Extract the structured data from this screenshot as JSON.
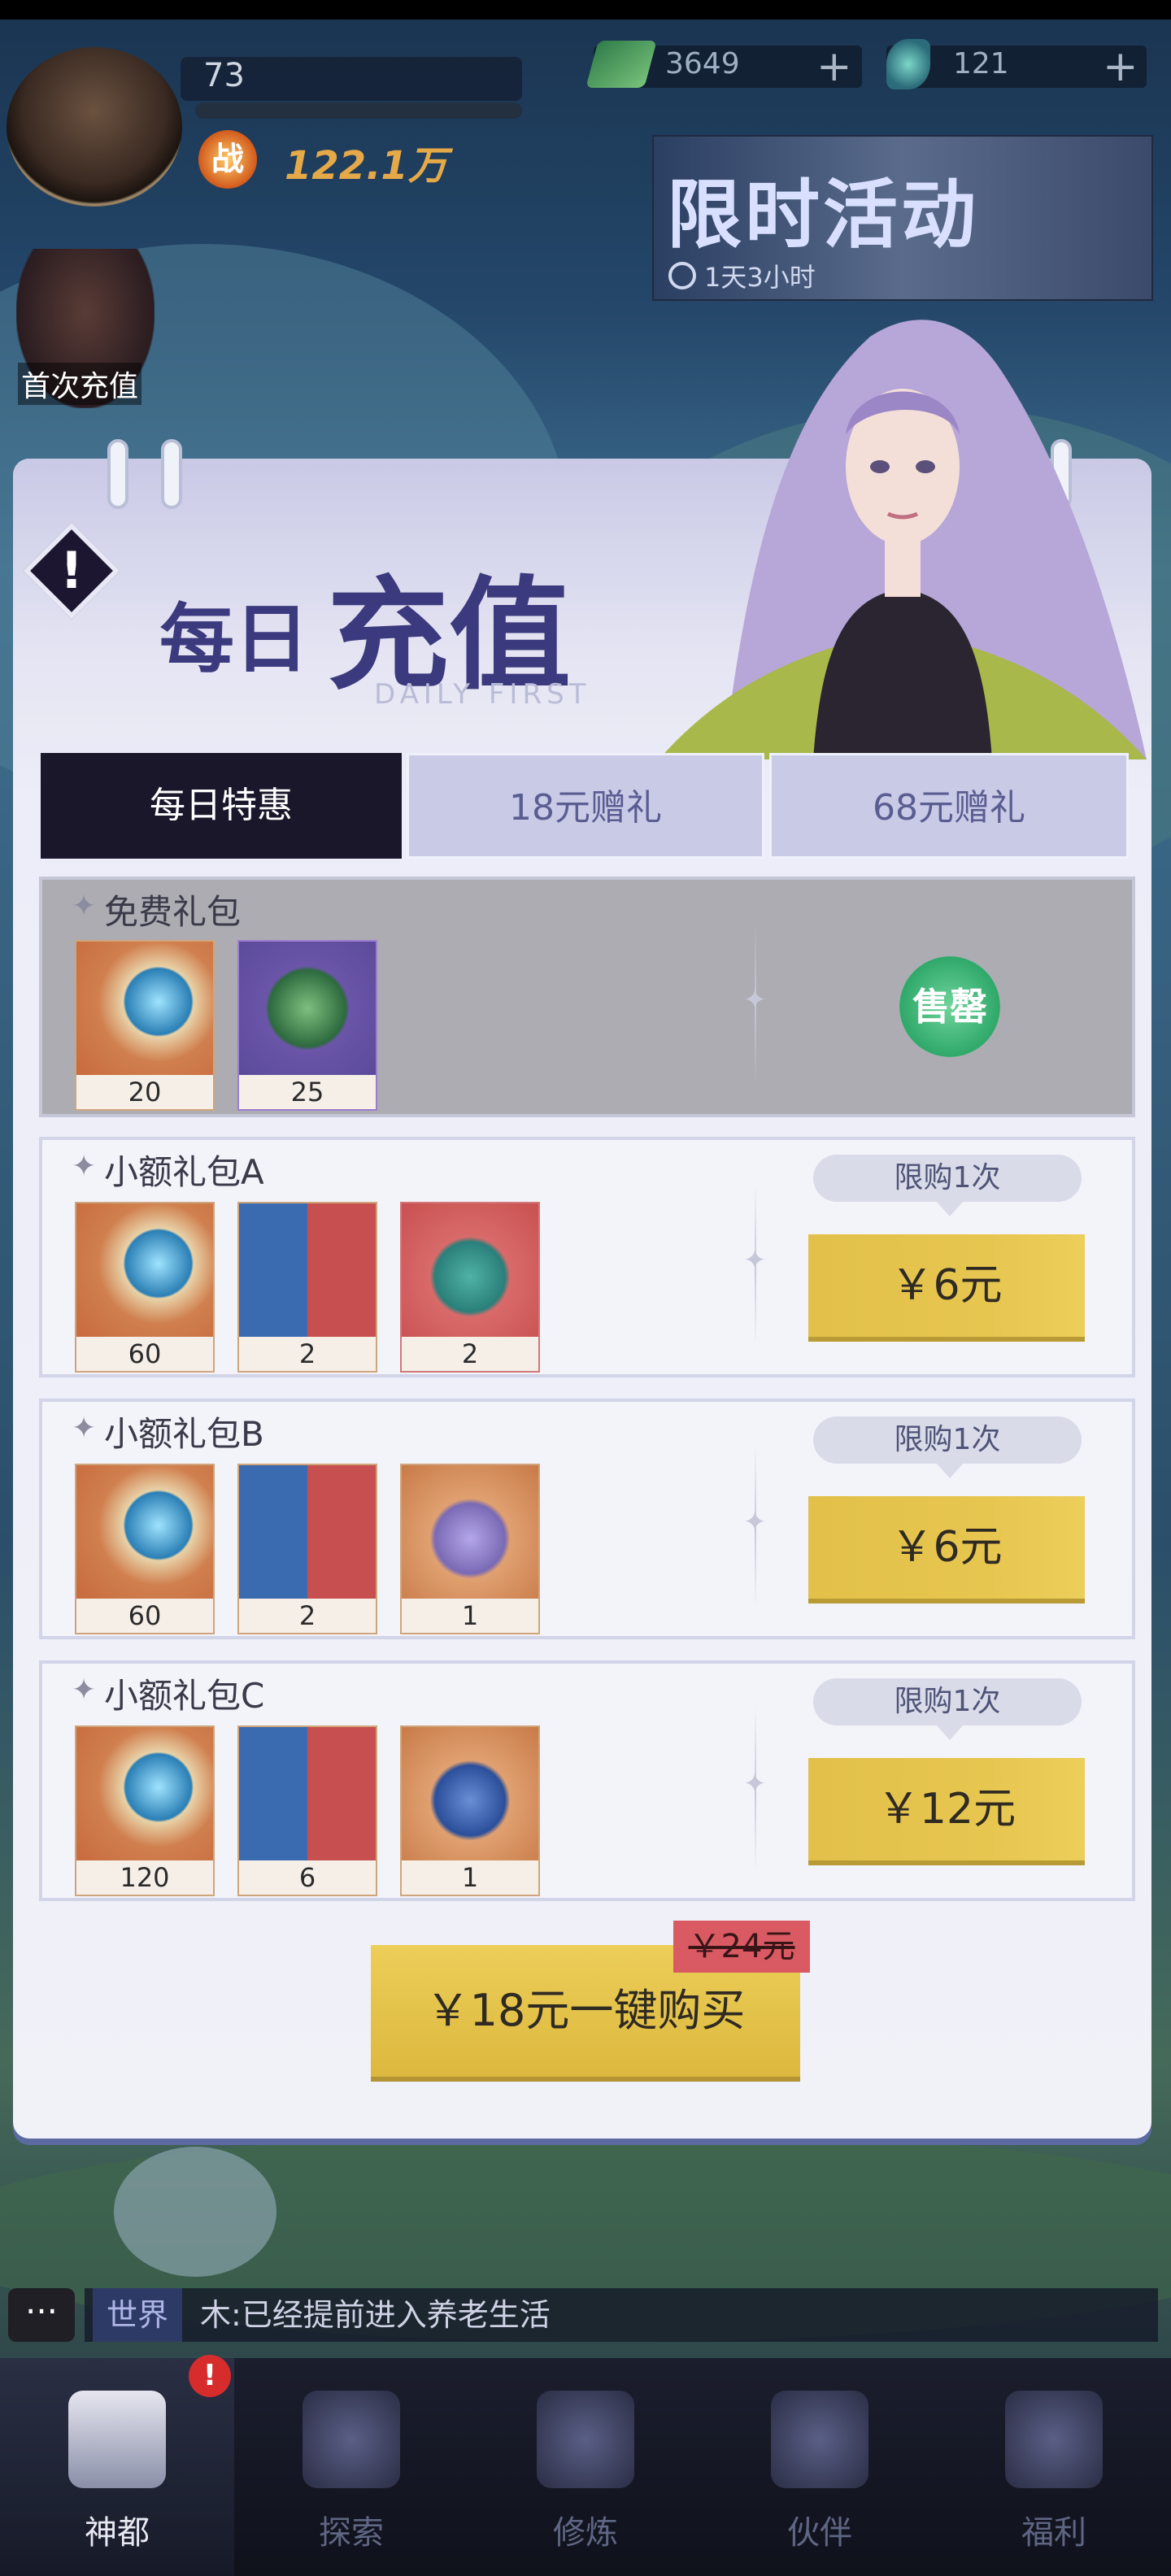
{
  "hud": {
    "level": "73",
    "power_icon": "战",
    "power": "122.1万",
    "currency1": {
      "value": "3649",
      "icon": "cash-icon"
    },
    "currency2": {
      "value": "121",
      "icon": "feather-icon"
    },
    "event": {
      "title": "限时活动",
      "timer": "1天3小时"
    },
    "first_charge": "首次充值"
  },
  "popup": {
    "title_small": "每日",
    "title_big": "充值",
    "subtitle": "DAILY FIRST",
    "tabs": [
      {
        "label": "每日特惠",
        "active": true
      },
      {
        "label": "18元赠礼",
        "active": false
      },
      {
        "label": "68元赠礼",
        "active": false
      }
    ],
    "packs": [
      {
        "name": "免费礼包",
        "items": [
          {
            "icon": "crescent-gem-icon",
            "count": "20"
          },
          {
            "icon": "green-orb-icon",
            "count": "25"
          }
        ],
        "status": "售罄"
      },
      {
        "name": "小额礼包A",
        "limit": "限购1次",
        "price": "￥6元",
        "items": [
          {
            "icon": "crescent-gem-icon",
            "count": "60"
          },
          {
            "icon": "card-icon",
            "count": "2"
          },
          {
            "icon": "teal-bag-icon",
            "count": "2"
          }
        ]
      },
      {
        "name": "小额礼包B",
        "limit": "限购1次",
        "price": "￥6元",
        "items": [
          {
            "icon": "crescent-gem-icon",
            "count": "60"
          },
          {
            "icon": "card-icon",
            "count": "2"
          },
          {
            "icon": "purple-bag-icon",
            "count": "1"
          }
        ]
      },
      {
        "name": "小额礼包C",
        "limit": "限购1次",
        "price": "￥12元",
        "items": [
          {
            "icon": "crescent-gem-icon",
            "count": "120"
          },
          {
            "icon": "card-icon",
            "count": "6"
          },
          {
            "icon": "blue-bag-icon",
            "count": "1"
          }
        ]
      }
    ],
    "buy_all": "￥18元一键购买",
    "original_price": "￥24元"
  },
  "chat": {
    "channel": "世界",
    "message": "木:已经提前进入养老生活"
  },
  "nav": {
    "badge": "!",
    "items": [
      "神都",
      "探索",
      "修炼",
      "伙伴",
      "福利"
    ]
  },
  "colors": {
    "accent": "#3c3a7e",
    "price_gold": "#e2c04a",
    "sold_out": "#2fa86a"
  }
}
